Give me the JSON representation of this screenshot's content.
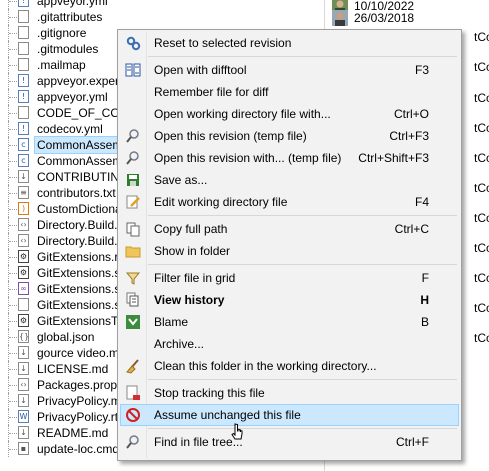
{
  "tree_files": [
    {
      "name": "appveyor.yml",
      "icon": "file-icon",
      "variant": "blue",
      "glyph": "!"
    },
    {
      "name": ".gitattributes",
      "icon": "file-icon",
      "variant": "",
      "glyph": ""
    },
    {
      "name": ".gitignore",
      "icon": "file-icon",
      "variant": "",
      "glyph": ""
    },
    {
      "name": ".gitmodules",
      "icon": "file-icon",
      "variant": "",
      "glyph": ""
    },
    {
      "name": ".mailmap",
      "icon": "file-icon",
      "variant": "",
      "glyph": ""
    },
    {
      "name": "appveyor.experi",
      "icon": "warning-file-icon",
      "variant": "blue",
      "glyph": "!"
    },
    {
      "name": "appveyor.yml",
      "icon": "warning-file-icon",
      "variant": "blue",
      "glyph": "!"
    },
    {
      "name": "CODE_OF_CONDU",
      "icon": "file-icon",
      "variant": "",
      "glyph": ""
    },
    {
      "name": "codecov.yml",
      "icon": "warning-file-icon",
      "variant": "blue",
      "glyph": "!"
    },
    {
      "name": "CommonAssembl",
      "icon": "csharp-file-icon",
      "variant": "blue",
      "glyph": "c"
    },
    {
      "name": "CommonAssembl",
      "icon": "csharp-file-icon",
      "variant": "blue",
      "glyph": "c"
    },
    {
      "name": "CONTRIBUTING.",
      "icon": "markdown-file-icon",
      "variant": "",
      "glyph": "↓"
    },
    {
      "name": "contributors.txt",
      "icon": "text-file-icon",
      "variant": "",
      "glyph": "≡"
    },
    {
      "name": "CustomDictionary",
      "icon": "rss-file-icon",
      "variant": "orange",
      "glyph": ")"
    },
    {
      "name": "Directory.Build.p",
      "icon": "file-icon",
      "variant": "",
      "glyph": "‹›"
    },
    {
      "name": "Directory.Build.ta",
      "icon": "file-icon",
      "variant": "",
      "glyph": "‹›"
    },
    {
      "name": "GitExtensions.rul",
      "icon": "settings-file-icon",
      "variant": "gear",
      "glyph": "⚙"
    },
    {
      "name": "GitExtensions.se",
      "icon": "settings-file-icon",
      "variant": "gear",
      "glyph": "⚙"
    },
    {
      "name": "GitExtensions.sln",
      "icon": "solution-file-icon",
      "variant": "purple",
      "glyph": "∞"
    },
    {
      "name": "GitExtensions.sln",
      "icon": "file-icon",
      "variant": "",
      "glyph": ""
    },
    {
      "name": "GitExtensionsTes",
      "icon": "settings-file-icon",
      "variant": "gear",
      "glyph": "⚙"
    },
    {
      "name": "global.json",
      "icon": "json-file-icon",
      "variant": "",
      "glyph": "{}"
    },
    {
      "name": "gource video.md",
      "icon": "markdown-file-icon",
      "variant": "",
      "glyph": "↓"
    },
    {
      "name": "LICENSE.md",
      "icon": "markdown-file-icon",
      "variant": "",
      "glyph": "↓"
    },
    {
      "name": "Packages.props",
      "icon": "file-icon",
      "variant": "",
      "glyph": "‹›"
    },
    {
      "name": "PrivacyPolicy.md",
      "icon": "markdown-file-icon",
      "variant": "",
      "glyph": "↓"
    },
    {
      "name": "PrivacyPolicy.rtf",
      "icon": "rtf-file-icon",
      "variant": "blue",
      "glyph": "W"
    },
    {
      "name": "README.md",
      "icon": "markdown-file-icon",
      "variant": "",
      "glyph": "↓"
    },
    {
      "name": "update-loc.cmd",
      "icon": "cmd-file-icon",
      "variant": "",
      "glyph": "▪"
    }
  ],
  "history": [
    {
      "date": "10/10/2022",
      "author": ""
    },
    {
      "date": "26/03/2018",
      "author": ""
    },
    {
      "date": "",
      "author": "tCom"
    },
    {
      "date": "",
      "author": "tCom"
    },
    {
      "date": "",
      "author": "tCom"
    },
    {
      "date": "",
      "author": "tCom"
    },
    {
      "date": "",
      "author": "tCom"
    },
    {
      "date": "",
      "author": "tCom"
    },
    {
      "date": "",
      "author": "tCom"
    },
    {
      "date": "",
      "author": "tCom"
    },
    {
      "date": "",
      "author": "tCom"
    },
    {
      "date": "",
      "author": "tCom"
    },
    {
      "date": "",
      "author": "tCom"
    }
  ],
  "menu": [
    {
      "label": "Reset to selected revision",
      "shortcut": "",
      "icon": "reset-icon"
    },
    {
      "sep": true
    },
    {
      "label": "Open with difftool",
      "shortcut": "F3",
      "icon": "difftool-icon"
    },
    {
      "label": "Remember file for diff",
      "shortcut": "",
      "icon": ""
    },
    {
      "label": "Open working directory file with...",
      "shortcut": "Ctrl+O",
      "icon": ""
    },
    {
      "label": "Open this revision (temp file)",
      "shortcut": "Ctrl+F3",
      "icon": "magnifier-icon"
    },
    {
      "label": "Open this revision with... (temp file)",
      "shortcut": "Ctrl+Shift+F3",
      "icon": "magnifier-icon"
    },
    {
      "label": "Save as...",
      "shortcut": "",
      "icon": "save-icon"
    },
    {
      "label": "Edit working directory file",
      "shortcut": "F4",
      "icon": "edit-icon"
    },
    {
      "sep": true
    },
    {
      "label": "Copy full path",
      "shortcut": "Ctrl+C",
      "icon": "copy-icon"
    },
    {
      "label": "Show in folder",
      "shortcut": "",
      "icon": "folder-icon"
    },
    {
      "sep": true
    },
    {
      "label": "Filter file in grid",
      "shortcut": "F",
      "icon": "filter-icon"
    },
    {
      "label": "View history",
      "shortcut": "H",
      "icon": "history-icon",
      "bold": true
    },
    {
      "label": "Blame",
      "shortcut": "B",
      "icon": "blame-icon"
    },
    {
      "label": "Archive...",
      "shortcut": "",
      "icon": ""
    },
    {
      "label": "Clean this folder in the working directory...",
      "shortcut": "",
      "icon": "broom-icon"
    },
    {
      "sep": true
    },
    {
      "label": "Stop tracking this file",
      "shortcut": "",
      "icon": "stop-tracking-icon"
    },
    {
      "label": "Assume unchanged this file",
      "shortcut": "",
      "icon": "no-entry-icon",
      "hover": true
    },
    {
      "sep": true
    },
    {
      "label": "Find in file tree...",
      "shortcut": "Ctrl+F",
      "icon": "magnifier-icon"
    }
  ]
}
